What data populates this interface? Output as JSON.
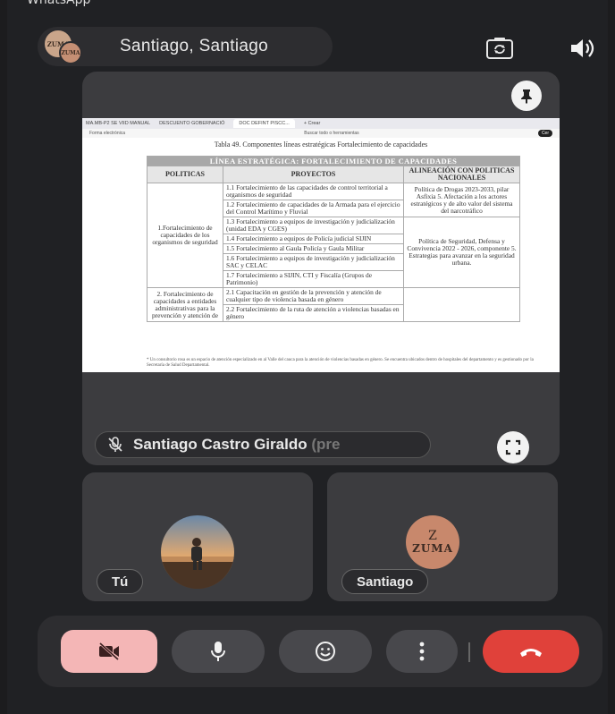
{
  "status_bar": {
    "app": "WhatsApp"
  },
  "header": {
    "call_title": "Santiago, Santiago",
    "avatar_text": "ZUMA",
    "switch_camera_icon": "camera-switch-icon",
    "speaker_icon": "speaker-icon"
  },
  "shared_screen": {
    "browser": {
      "tabs": [
        "MA.MB-P2 SE VIID MANUAL",
        "DESCUENTO GOBERNACIÓ",
        "DOC DEFINT PISCC...",
        "+ Crear"
      ],
      "toolbar_left": "Forma electrónica",
      "toolbar_search": "Buscar todo o herramientas",
      "toolbar_cta": "Cer"
    },
    "table_caption": "Tabla 49. Componentes líneas estratégicas Fortalecimiento de capacidades",
    "table": {
      "banner": "LÍNEA ESTRATÉGICA: FORTALECIMIENTO DE CAPACIDADES",
      "headers": [
        "POLITICAS",
        "PROYECTOS",
        "ALINEACIÓN CON POLITICAS NACIONALES"
      ],
      "policy_1": "1.Fortalecimiento de capacidades de los organismos de seguridad",
      "policy_2": "2. Fortalecimiento de capacidades a entidades administrativas para la prevención y atención de",
      "projects": [
        "1.1 Fortalecimiento de las capacidades de control territorial a organismos de seguridad",
        "1.2 Fortalecimiento de capacidades de la Armada para el ejercicio del Control Marítimo y Fluvial",
        "1.3 Fortalecimiento a equipos de investigación y judicialización (unidad EDA y CGES)",
        "1.4 Fortalecimiento a equipos de Policía judicial SIJIN",
        "1.5 Fortalecimiento al Gaula Policía y Gaula Militar",
        "1.6 Fortalecimiento a equipos de investigación y judicialización SAC y CELAC",
        "1.7 Fortalecimiento a SIJIN, CTI y Fiscalía (Grupos de Patrimonio)",
        "2.1 Capacitación en gestión de la prevención y atención de cualquier tipo de violencia basada en género",
        "2.2 Fortalecimiento de la ruta de atención a violencias basadas en género"
      ],
      "alignment_1": "Política de Drogas 2023-2033, pilar Asfixia 5. Afectación a los actores estratégicos y de alto valor del sistema del narcotráfico",
      "alignment_2": "Política de Seguridad, Defensa y Convivencia 2022 - 2026, componente 5. Estrategias para avanzar en la seguridad urbana."
    },
    "footnote": "* Un consultorio rosa es un espacio de atención especializado en al Valle del cauca para la atención de violencias basadas en género. Se encuentra ubicados dentro de hospitales del departamento y es gestionado por la Secretaría de Salud Departamental."
  },
  "presenter": {
    "name": "Santiago Castro Giraldo",
    "name_suffix": "(pre",
    "mic_state": "muted"
  },
  "participants": [
    {
      "label": "Tú"
    },
    {
      "label": "Santiago",
      "avatar_text_top": "Z",
      "avatar_text": "ZUMA"
    }
  ],
  "controls": {
    "video": "video-off-icon",
    "mic": "mic-icon",
    "emoji": "emoji-icon",
    "more": "more-vert-icon",
    "end": "end-call-icon"
  },
  "colors": {
    "end_call": "#e0413a",
    "video_off_bg": "#f4b6b6",
    "tile_bg": "#3c3c3f"
  }
}
